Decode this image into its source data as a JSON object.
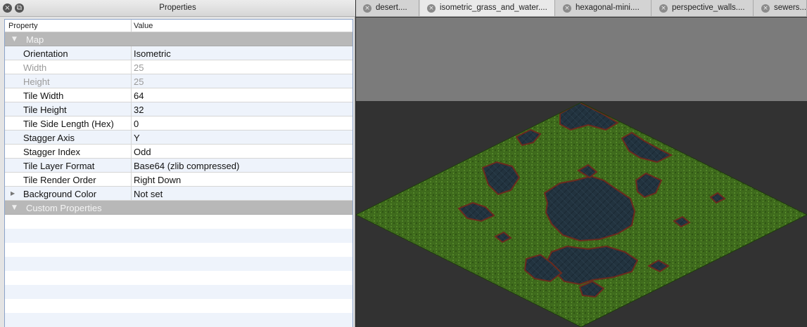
{
  "panel": {
    "title": "Properties",
    "columns": {
      "property": "Property",
      "value": "Value"
    }
  },
  "groups": {
    "map": "Map",
    "custom": "Custom Properties"
  },
  "rows": [
    {
      "key": "Orientation",
      "value": "Isometric"
    },
    {
      "key": "Width",
      "value": "25"
    },
    {
      "key": "Height",
      "value": "25"
    },
    {
      "key": "Tile Width",
      "value": "64"
    },
    {
      "key": "Tile Height",
      "value": "32"
    },
    {
      "key": "Tile Side Length (Hex)",
      "value": "0"
    },
    {
      "key": "Stagger Axis",
      "value": "Y"
    },
    {
      "key": "Stagger Index",
      "value": "Odd"
    },
    {
      "key": "Tile Layer Format",
      "value": "Base64 (zlib compressed)"
    },
    {
      "key": "Tile Render Order",
      "value": "Right Down"
    },
    {
      "key": "Background Color",
      "value": "Not set"
    }
  ],
  "tabs": [
    {
      "label": "desert...."
    },
    {
      "label": "isometric_grass_and_water...."
    },
    {
      "label": "hexagonal-mini...."
    },
    {
      "label": "perspective_walls...."
    },
    {
      "label": "sewers...."
    }
  ],
  "colors": {
    "grass": "#3e6a1c",
    "water": "#22333f",
    "shore": "#6b2a1e"
  },
  "icons": {
    "close": "close-icon",
    "float": "float-icon",
    "tab_close": "tab-close-icon",
    "collapse": "triangle-down-icon",
    "expand": "triangle-right-icon"
  }
}
